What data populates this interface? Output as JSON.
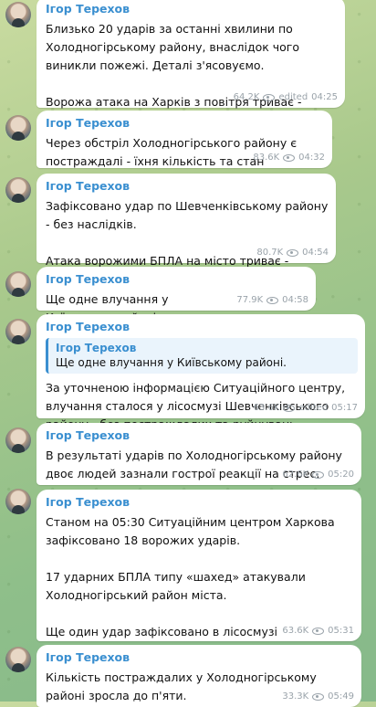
{
  "author": "Ігор Терехов",
  "messages": [
    {
      "text": "Близько 20 ударів за останні хвилини по Холодногірському району, внаслідок чого виникли пожежі. Деталі з'ясовуємо.\n\nВорожа атака на Харків з повітря триває - будьте обережні!",
      "views": "64.2K",
      "edited": "edited",
      "time": "04:25"
    },
    {
      "text": "Через обстріл Холодногірського району є постраждалі - їхня кількість та стан уточнюються.",
      "views": "83.6K",
      "edited": "",
      "time": "04:32"
    },
    {
      "text": "Зафіксовано удар по Шевченківському району - без наслідків.\n\nАтака ворожими БПЛА на місто триває - будьте обережні!",
      "views": "80.7K",
      "edited": "",
      "time": "04:54"
    },
    {
      "text": "Ще одне влучання у Київському районі.",
      "views": "77.9K",
      "edited": "",
      "time": "04:58"
    },
    {
      "quote_name": "Ігор Терехов",
      "quote_text": "Ще одне влучання у Київському районі.",
      "text": "За уточненою інформацією Ситуаційного центру, влучання сталося у лісосмузі Шевченківського району - без постраждалих та руйнувань.",
      "views": "63.6K",
      "edited": "edited",
      "time": "05:17"
    },
    {
      "text": "В результаті ударів по Холодногірському району двоє людей зазнали гострої реакції на стрес.",
      "views": "62.6K",
      "edited": "",
      "time": "05:20"
    },
    {
      "text": "Станом на 05:30 Ситуаційним центром Харкова зафіксовано 18 ворожих ударів.\n\n17 ударних БПЛА типу «шахед» атакували Холодногірський район міста.\n\nЩе один удар зафіксовано в лісосмузі Шевченківського району.",
      "views": "63.6K",
      "edited": "",
      "time": "05:31"
    },
    {
      "text": "Кількість постраждалих у Холодногірському районі зросла до п'яти.",
      "views": "33.3K",
      "edited": "",
      "time": "05:49"
    }
  ]
}
